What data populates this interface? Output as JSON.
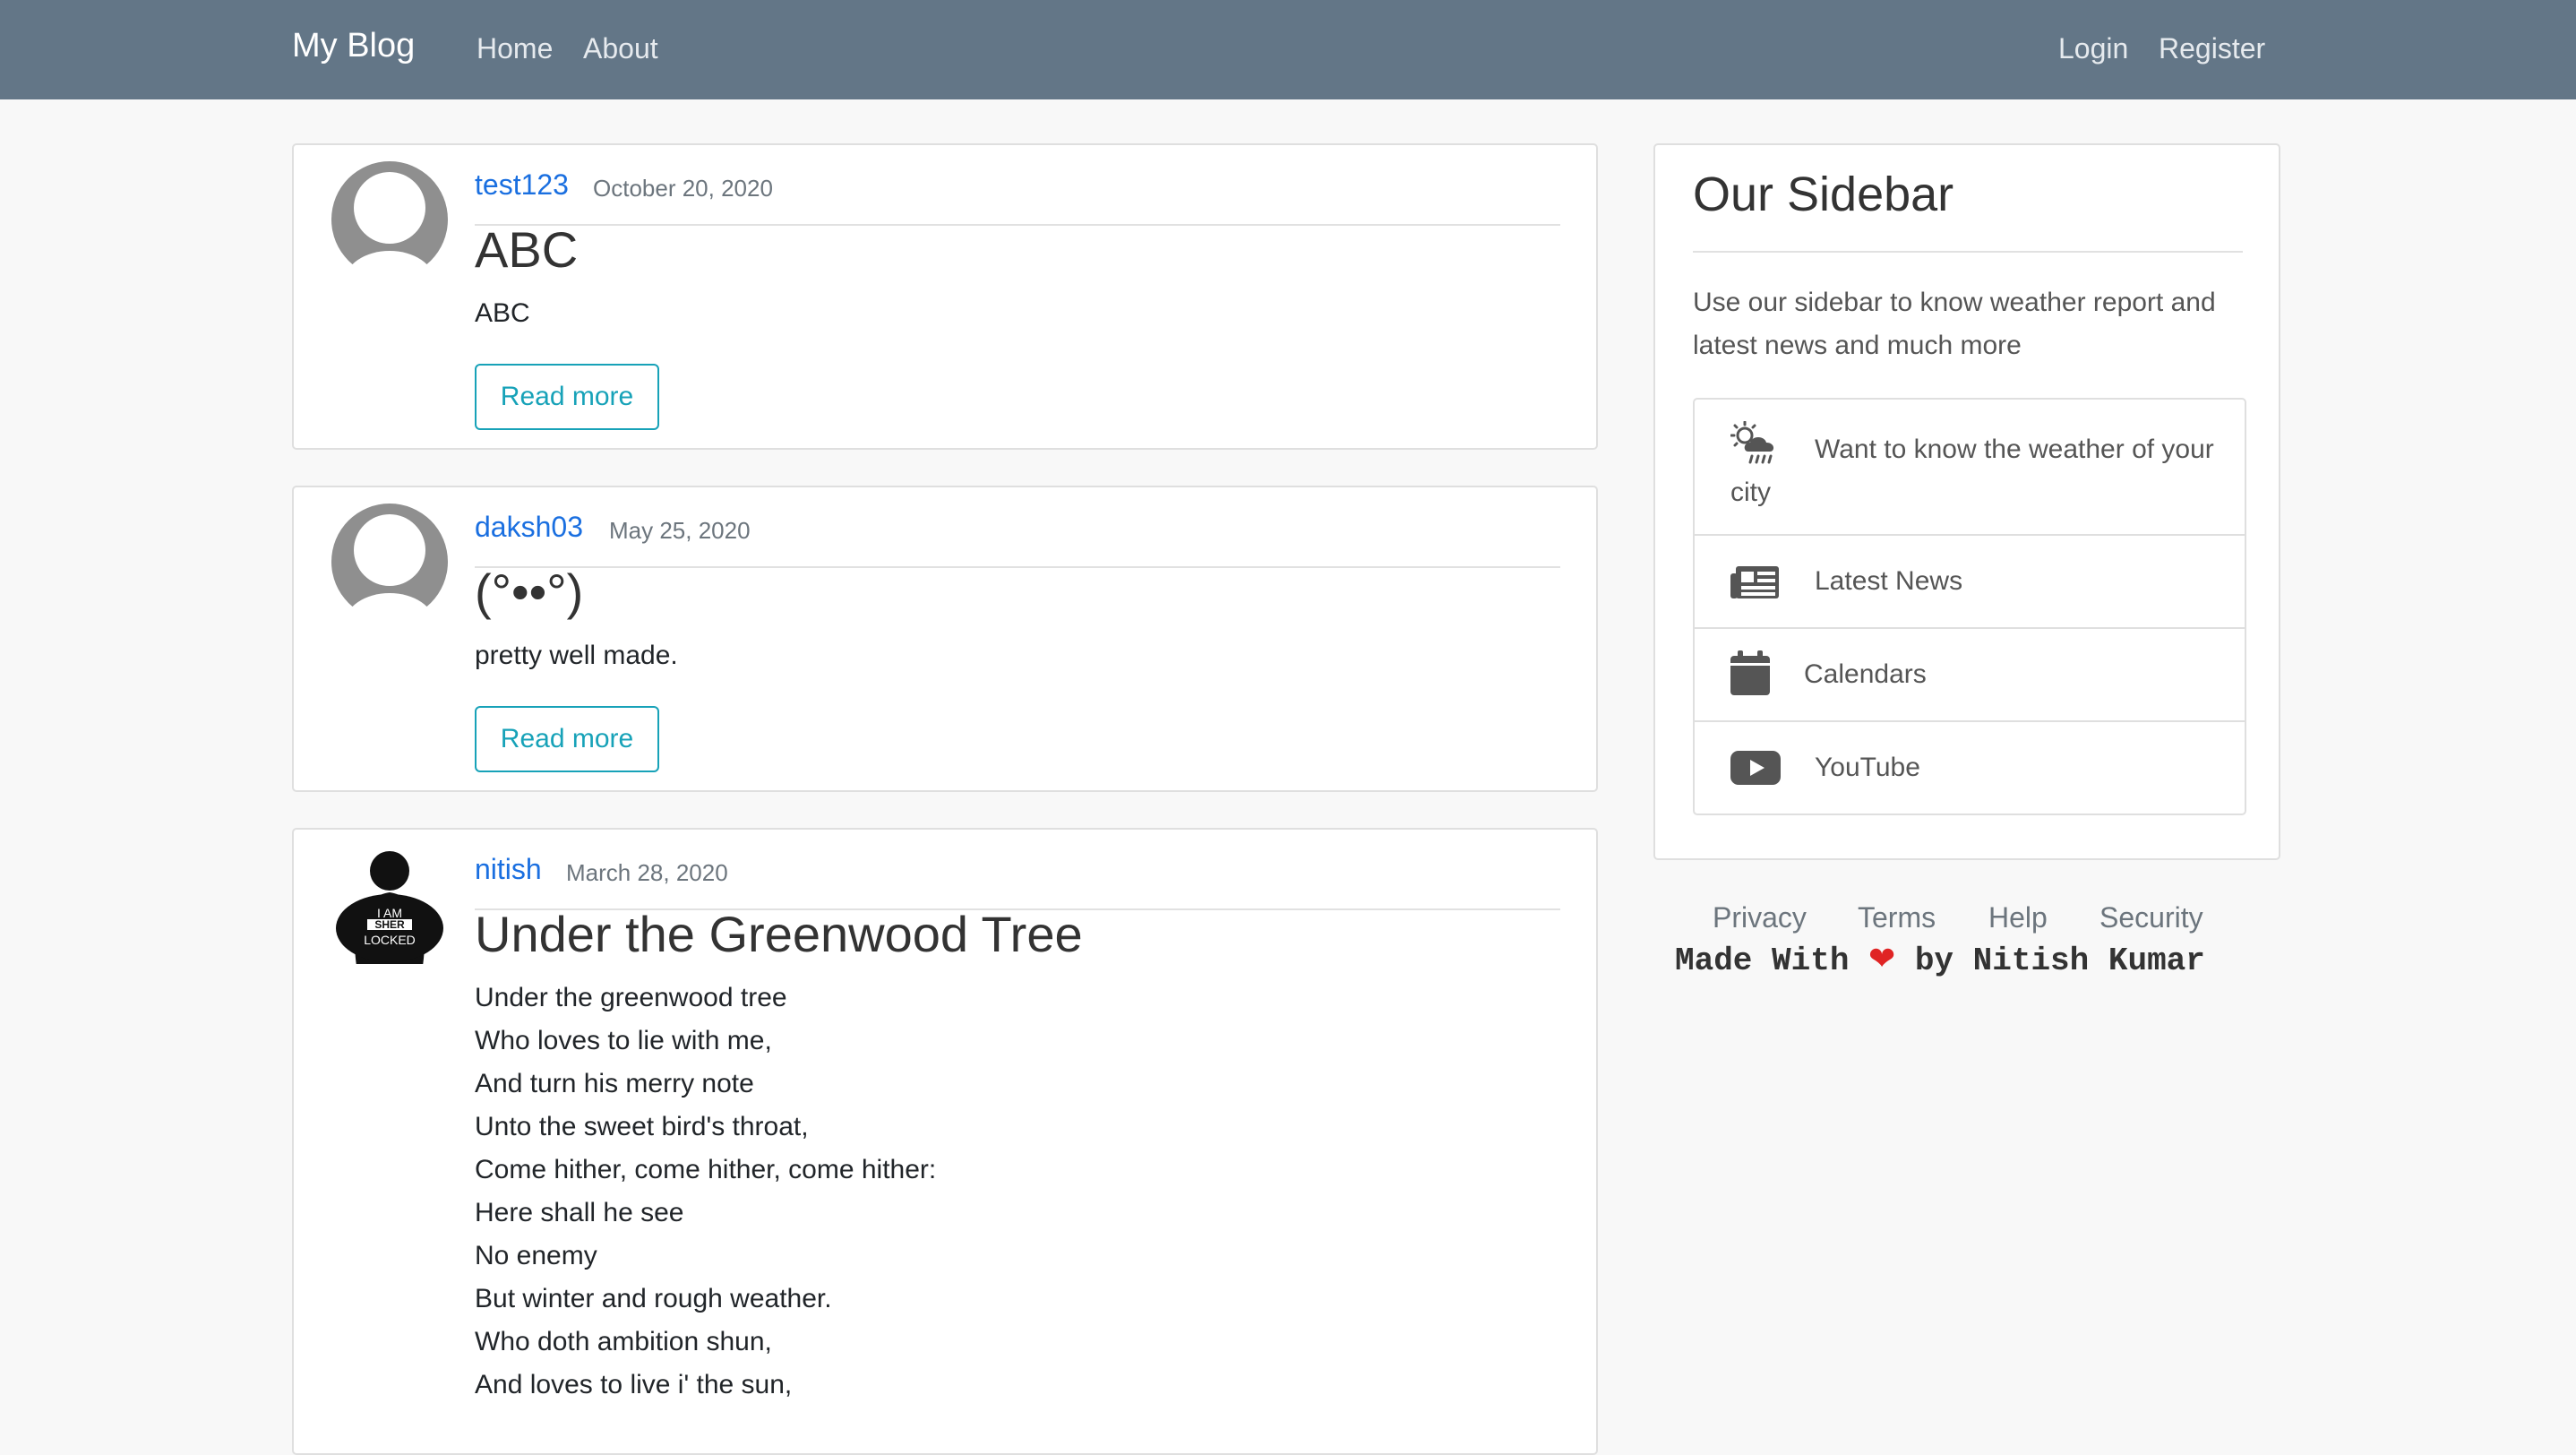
{
  "nav": {
    "brand": "My Blog",
    "links": [
      "Home",
      "About"
    ],
    "auth": [
      "Login",
      "Register"
    ]
  },
  "posts": [
    {
      "author": "test123",
      "date": "October 20, 2020",
      "title": "ABC",
      "content": "ABC",
      "button": "Read more",
      "avatar": "default-avatar"
    },
    {
      "author": "daksh03",
      "date": "May 25, 2020",
      "title": "(°••°)",
      "content": "pretty well made.",
      "button": "Read more",
      "avatar": "default-avatar"
    },
    {
      "author": "nitish",
      "date": "March 28, 2020",
      "title": "Under the Greenwood Tree",
      "content": "Under the greenwood tree\nWho loves to lie with me,\nAnd turn his merry note\nUnto the sweet bird's throat,\nCome hither, come hither, come hither:\nHere shall he see\nNo enemy\nBut winter and rough weather.\nWho doth ambition shun,\nAnd loves to live i' the sun,",
      "avatar": "sherlock-avatar",
      "avatar_text": "I AM SHER LOCKED"
    }
  ],
  "sidebar": {
    "title": "Our Sidebar",
    "description": "Use our sidebar to know weather report and latest news and much more",
    "items": [
      {
        "label": "Want to know the weather of your city",
        "icon": "weather-icon"
      },
      {
        "label": "Latest News",
        "icon": "newspaper-icon"
      },
      {
        "label": "Calendars",
        "icon": "calendar-icon"
      },
      {
        "label": "YouTube",
        "icon": "youtube-icon"
      }
    ]
  },
  "footer": {
    "links": [
      "Privacy",
      "Terms",
      "Help",
      "Security"
    ],
    "made_prefix": "Made With",
    "heart": "❤",
    "made_suffix": "by Nitish Kumar"
  },
  "colors": {
    "navbar": "#637687",
    "link": "#1a6fe0",
    "button": "#17a2b8",
    "heart": "#e02424"
  }
}
